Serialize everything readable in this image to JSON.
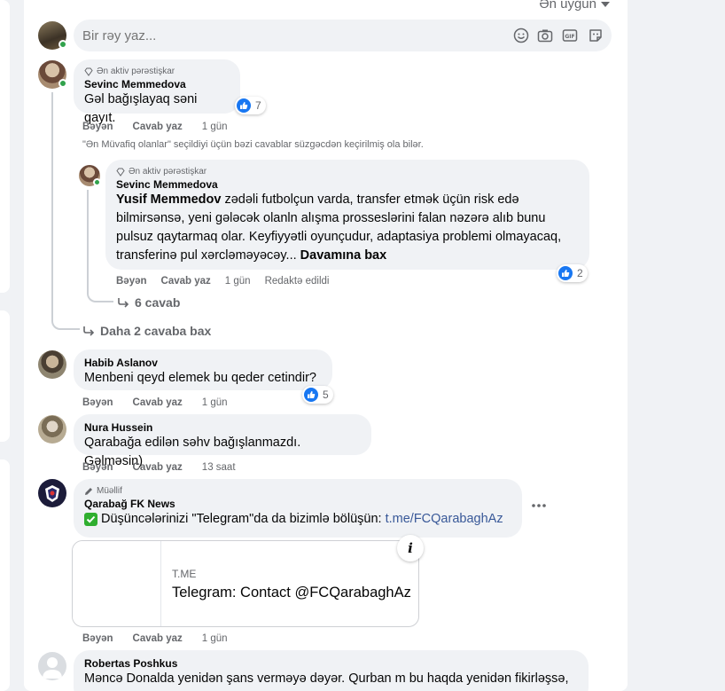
{
  "sort": {
    "label": "Ən uyğun"
  },
  "composer": {
    "placeholder": "Bir rəy yaz..."
  },
  "comments": [
    {
      "badge": "Ən aktiv pərəstişkar",
      "author": "Sevinc Memmedova",
      "text": "Gəl bağışlayaq səni qayıt.",
      "reactions": "7",
      "actions": {
        "like": "Bəyən",
        "reply": "Cavab yaz",
        "time": "1 gün"
      }
    },
    {
      "badge": "Ən aktiv pərəstişkar",
      "author": "Sevinc Memmedova",
      "mention": "Yusif Memmedov",
      "text": " zədəli futbolçun varda, transfer etmək üçün risk edə bilmirsənsə, yeni gələcək olanln alışma prosseslərini falan nəzərə alıb bunu pulsuz qaytarmaq olar. Keyfiyyətli oyunçudur, adaptasiya problemi olmayacaq, transferinə pul xərcləməyəcəy...",
      "see_more": " Davamına bax",
      "reactions": "2",
      "actions": {
        "like": "Bəyən",
        "reply": "Cavab yaz",
        "time": "1 gün",
        "edited": "Redaktə edildi"
      },
      "replies_link": "6 cavab"
    },
    {
      "author": "Habib Aslanov",
      "text": "Menbeni qeyd elemek bu qeder cetindir?",
      "reactions": "5",
      "actions": {
        "like": "Bəyən",
        "reply": "Cavab yaz",
        "time": "1 gün"
      }
    },
    {
      "author": "Nura Hussein",
      "text": "Qarabağa edilən səhv bağışlanmazdı. Gəlməsin)",
      "actions": {
        "like": "Bəyən",
        "reply": "Cavab yaz",
        "time": "13 saat"
      }
    },
    {
      "badge": "Müəllif",
      "author": "Qarabağ FK News",
      "text": "Düşüncələrinizi \"Telegram\"da da bizimlə bölüşün: ",
      "link": "t.me/FCQarabaghAz",
      "actions": {
        "like": "Bəyən",
        "reply": "Cavab yaz",
        "time": "1 gün"
      },
      "card": {
        "domain": "T.ME",
        "title": "Telegram: Contact @FCQarabaghAz"
      }
    },
    {
      "author": "Robertas Poshkus",
      "text": "Məncə Donalda yenidən şans verməyə dəyər. Qurban m bu haqda yenidən fikirləşsə,"
    }
  ],
  "filter_note": "\"Ən Müvafiq olanlar\" seçildiyi üçün bəzi cavablar süzgəcdən keçirilmiş ola bilər.",
  "more_replies": "Daha 2 cavaba bax",
  "colors": {
    "link": "#385898",
    "like": "#1877f2",
    "online": "#31a24c",
    "bubble": "#f0f2f5"
  }
}
